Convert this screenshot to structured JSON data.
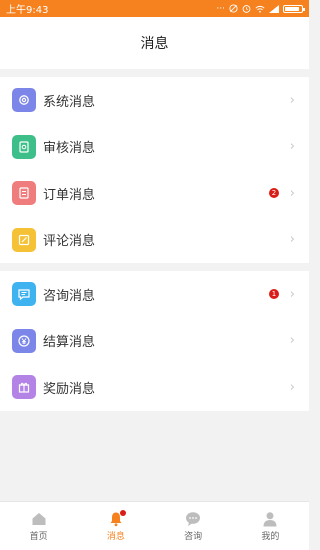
{
  "status_bar": {
    "time": "上午9:43",
    "icons": [
      "more-dots-icon",
      "mute-icon",
      "alarm-icon",
      "wifi-icon",
      "signal-icon",
      "battery-icon"
    ],
    "battery_level": 0.9
  },
  "header": {
    "title": "消息"
  },
  "colors": {
    "accent": "#f5821f",
    "badge": "#d91e18"
  },
  "groups": [
    {
      "items": [
        {
          "label": "系统消息",
          "icon": "gear-icon",
          "color": "#7b86e8",
          "badge": ""
        },
        {
          "label": "审核消息",
          "icon": "review-doc-icon",
          "color": "#3ebf8a",
          "badge": ""
        },
        {
          "label": "订单消息",
          "icon": "order-list-icon",
          "color": "#f07d7d",
          "badge": "2"
        },
        {
          "label": "评论消息",
          "icon": "edit-comment-icon",
          "color": "#f5c135",
          "badge": ""
        }
      ]
    },
    {
      "items": [
        {
          "label": "咨询消息",
          "icon": "chat-icon",
          "color": "#3fb3f0",
          "badge": "1"
        },
        {
          "label": "结算消息",
          "icon": "yen-icon",
          "color": "#7b86e8",
          "badge": ""
        },
        {
          "label": "奖励消息",
          "icon": "gift-icon",
          "color": "#b483e6",
          "badge": ""
        }
      ]
    }
  ],
  "tabbar": {
    "tabs": [
      {
        "label": "首页",
        "icon": "home-icon",
        "active": false
      },
      {
        "label": "消息",
        "icon": "bell-icon",
        "active": true
      },
      {
        "label": "咨询",
        "icon": "chat-bubble-icon",
        "active": false
      },
      {
        "label": "我的",
        "icon": "person-icon",
        "active": false
      }
    ]
  }
}
